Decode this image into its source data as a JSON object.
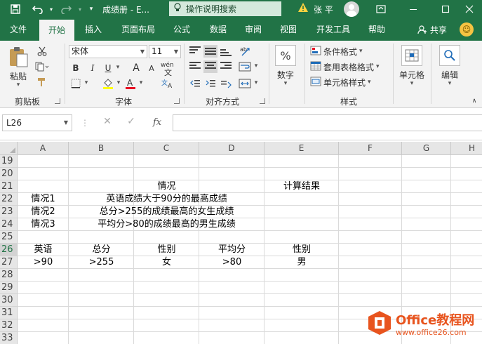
{
  "titlebar": {
    "doc_title": "成绩册 - E...",
    "tell_me": "操作说明搜索",
    "user_name": "张 平"
  },
  "tabs": [
    {
      "label": "文件"
    },
    {
      "label": "开始"
    },
    {
      "label": "插入"
    },
    {
      "label": "页面布局"
    },
    {
      "label": "公式"
    },
    {
      "label": "数据"
    },
    {
      "label": "审阅"
    },
    {
      "label": "视图"
    },
    {
      "label": "开发工具"
    },
    {
      "label": "帮助"
    }
  ],
  "share_label": "共享",
  "ribbon": {
    "clipboard": {
      "paste": "粘贴",
      "group": "剪贴板"
    },
    "font": {
      "name": "宋体",
      "size": "11",
      "group": "字体",
      "bold": "B",
      "italic": "I",
      "underline": "U",
      "grow": "A",
      "shrink": "A",
      "phonetic": "wén"
    },
    "alignment": {
      "group": "对齐方式"
    },
    "number": {
      "label": "数字",
      "symbol": "%"
    },
    "styles": {
      "conditional": "条件格式",
      "table": "套用表格格式",
      "cell": "单元格样式",
      "group": "样式"
    },
    "cells": {
      "label": "单元格"
    },
    "editing": {
      "label": "编辑"
    }
  },
  "formula_bar": {
    "name_box": "L26",
    "fx": "fx",
    "content": ""
  },
  "grid": {
    "columns": [
      "A",
      "B",
      "C",
      "D",
      "E",
      "F",
      "G",
      "H"
    ],
    "rows": [
      "19",
      "20",
      "21",
      "22",
      "23",
      "24",
      "25",
      "26",
      "27",
      "28",
      "29",
      "30",
      "31",
      "32",
      "33"
    ],
    "selected_row": "26",
    "cells": {
      "c21": "情况",
      "e21": "计算结果",
      "a22": "情况1",
      "b22": "英语成绩大于90分的最高成绩",
      "a23": "情况2",
      "b23": "总分>255的成绩最高的女生成绩",
      "a24": "情况3",
      "b24": "平均分>80的成绩最高的男生成绩",
      "a26": "英语",
      "b26": "总分",
      "c26": "性别",
      "d26": "平均分",
      "e26": "性别",
      "a27": ">90",
      "b27": ">255",
      "c27": "女",
      "d27": ">80",
      "e27": "男"
    }
  },
  "watermark": {
    "brand": "Office教程网",
    "url": "www.office26.com",
    "brand_color": "#e8541e"
  },
  "colors": {
    "excel_green": "#217346",
    "ribbon_bg": "#f3f3f3"
  }
}
